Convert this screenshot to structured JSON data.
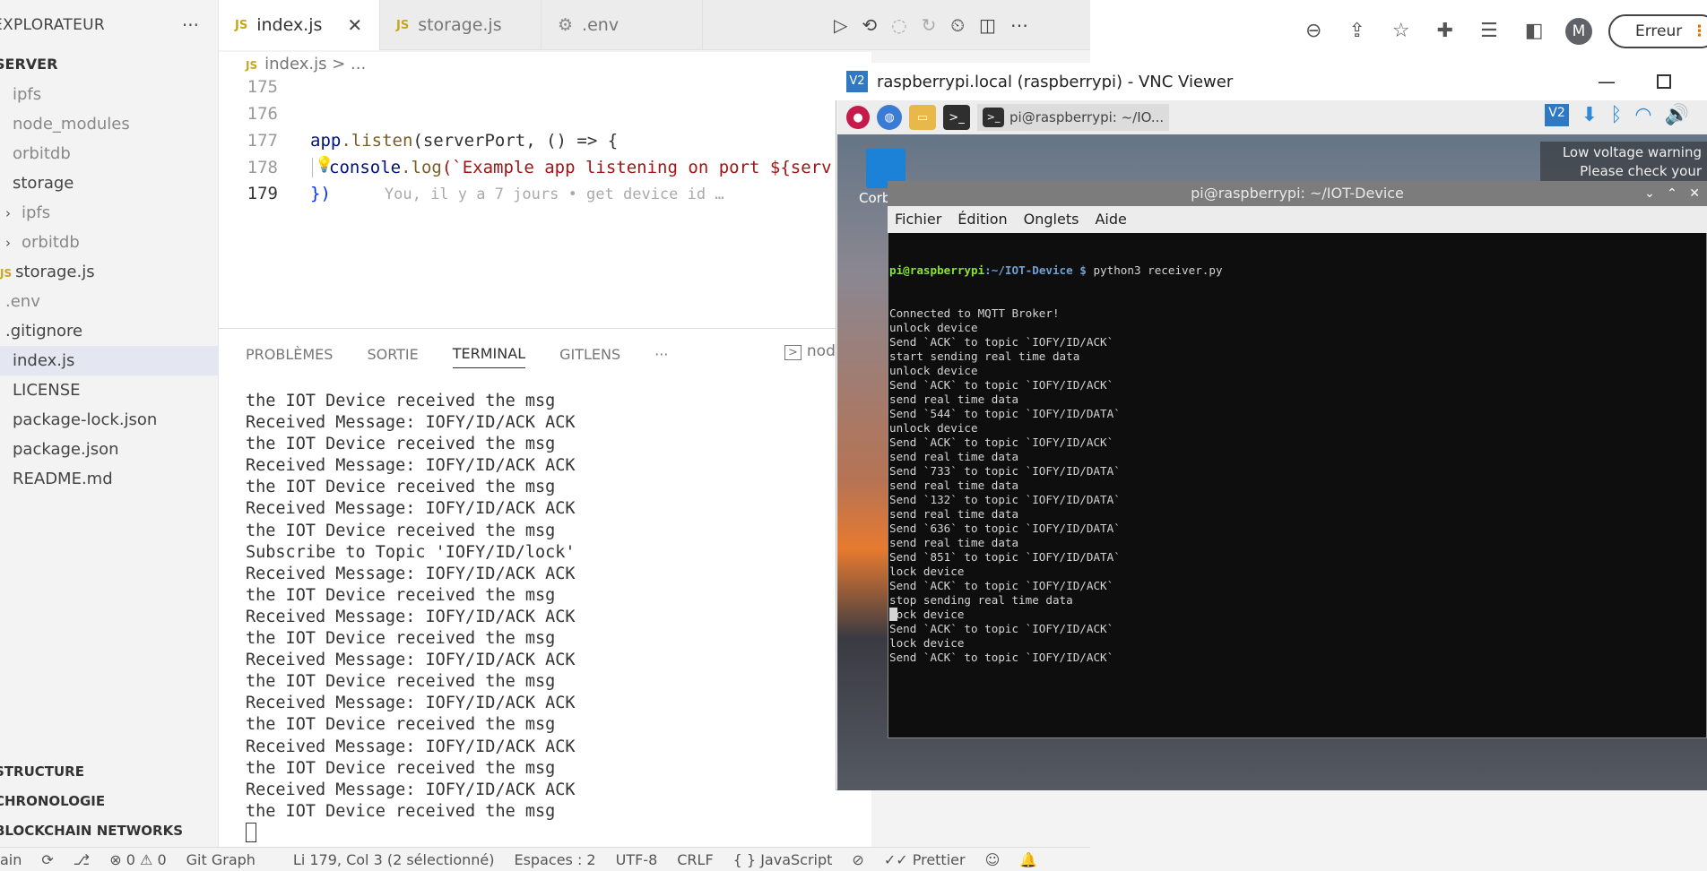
{
  "explorer": {
    "title": "EXPLORATEUR",
    "more": "···",
    "section": "SERVER",
    "items": [
      {
        "label": "ipfs",
        "type": "folder"
      },
      {
        "label": "node_modules",
        "type": "folder"
      },
      {
        "label": "orbitdb",
        "type": "folder"
      },
      {
        "label": "storage",
        "type": "folder-open"
      },
      {
        "label": "ipfs",
        "type": "subfolder"
      },
      {
        "label": "orbitdb",
        "type": "subfolder"
      },
      {
        "label": "storage.js",
        "type": "js"
      },
      {
        "label": ".env",
        "type": "file"
      },
      {
        "label": ".gitignore",
        "type": "file"
      },
      {
        "label": "index.js",
        "type": "file"
      },
      {
        "label": "LICENSE",
        "type": "file"
      },
      {
        "label": "package-lock.json",
        "type": "file"
      },
      {
        "label": "package.json",
        "type": "file"
      },
      {
        "label": "README.md",
        "type": "file"
      }
    ],
    "bottom_sections": [
      "STRUCTURE",
      "CHRONOLOGIE",
      "BLOCKCHAIN NETWORKS"
    ]
  },
  "editor": {
    "tabs": [
      {
        "label": "index.js",
        "active": true
      },
      {
        "label": "storage.js",
        "active": false
      },
      {
        "label": ".env",
        "active": false
      }
    ],
    "breadcrumb": {
      "file": "index.js",
      "rest": " > ..."
    },
    "line_numbers": [
      "175",
      "176",
      "177",
      "178",
      "179"
    ],
    "lines": {
      "l177a": "app",
      "l177b": ".listen",
      "l177c": "(serverPort, () => {",
      "l178a": "console",
      "l178b": ".log",
      "l178c": "(`Example app listening on port ${serv",
      "l179": "})",
      "blame": "You, il y a 7 jours • get device id …"
    }
  },
  "panel": {
    "tabs": [
      "PROBLÈMES",
      "SORTIE",
      "TERMINAL",
      "GITLENS"
    ],
    "active_tab": "TERMINAL",
    "more": "···",
    "node_label": "node",
    "output": [
      "the IOT Device received the msg",
      "Received Message: IOFY/ID/ACK ACK",
      "the IOT Device received the msg",
      "Received Message: IOFY/ID/ACK ACK",
      "the IOT Device received the msg",
      "Received Message: IOFY/ID/ACK ACK",
      "the IOT Device received the msg",
      "Subscribe to Topic 'IOFY/ID/lock'",
      "Received Message: IOFY/ID/ACK ACK",
      "the IOT Device received the msg",
      "Received Message: IOFY/ID/ACK ACK",
      "the IOT Device received the msg",
      "Received Message: IOFY/ID/ACK ACK",
      "the IOT Device received the msg",
      "Received Message: IOFY/ID/ACK ACK",
      "the IOT Device received the msg",
      "Received Message: IOFY/ID/ACK ACK",
      "the IOT Device received the msg",
      "Received Message: IOFY/ID/ACK ACK",
      "the IOT Device received the msg"
    ]
  },
  "statusbar": {
    "branch": "ain",
    "errors": "0",
    "warnings": "0",
    "git_graph": "Git Graph",
    "position": "Li 179, Col 3 (2 sélectionné)",
    "spaces": "Espaces : 2",
    "encoding": "UTF-8",
    "eol": "CRLF",
    "language": "JavaScript",
    "prettier": "Prettier"
  },
  "browser": {
    "avatar": "M",
    "error_button": "Erreur"
  },
  "vnc": {
    "title": "raspberrypi.local (raspberrypi) - VNC Viewer",
    "logo": "V2",
    "taskbar_item": "pi@raspberrypi: ~/IO...",
    "low_voltage_1": "Low voltage warning",
    "low_voltage_2": "Please check your power",
    "trash_label": "Corb",
    "terminal": {
      "title": "pi@raspberrypi: ~/IOT-Device",
      "menu": [
        "Fichier",
        "Édition",
        "Onglets",
        "Aide"
      ],
      "prompt_user": "pi@raspberrypi",
      "prompt_dir": ":~/IOT-Device $",
      "command": " python3 receiver.py",
      "lines": [
        "Connected to MQTT Broker!",
        "unlock device",
        "Send `ACK` to topic `IOFY/ID/ACK`",
        "start sending real time data",
        "unlock device",
        "Send `ACK` to topic `IOFY/ID/ACK`",
        "send real time data",
        "Send `544` to topic `IOFY/ID/DATA`",
        "unlock device",
        "Send `ACK` to topic `IOFY/ID/ACK`",
        "send real time data",
        "Send `733` to topic `IOFY/ID/DATA`",
        "send real time data",
        "Send `132` to topic `IOFY/ID/DATA`",
        "send real time data",
        "Send `636` to topic `IOFY/ID/DATA`",
        "send real time data",
        "Send `851` to topic `IOFY/ID/DATA`",
        "lock device",
        "Send `ACK` to topic `IOFY/ID/ACK`",
        "stop sending real time data",
        "lock device",
        "Send `ACK` to topic `IOFY/ID/ACK`",
        "lock device",
        "Send `ACK` to topic `IOFY/ID/ACK`"
      ]
    }
  }
}
